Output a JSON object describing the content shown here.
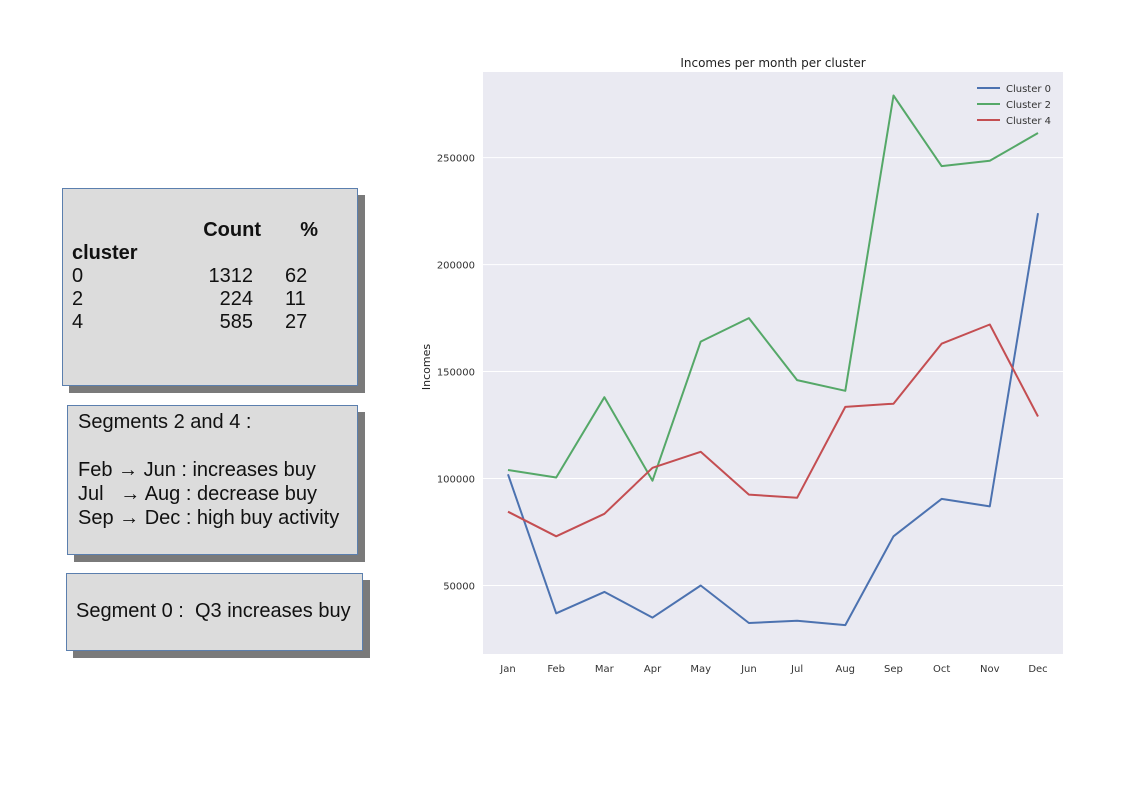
{
  "table": {
    "header_count": "Count",
    "header_pct": "%",
    "index_label": "cluster",
    "rows": [
      {
        "cluster": "0",
        "count": "1312",
        "pct": "62"
      },
      {
        "cluster": "2",
        "count": "224",
        "pct": "11"
      },
      {
        "cluster": "4",
        "count": "585",
        "pct": "27"
      }
    ]
  },
  "notes": {
    "segments_2_4": {
      "title": "Segments 2 and 4 :",
      "lines": [
        "Feb → Jun : increases buy",
        "Jul   → Aug : decrease buy",
        "Sep → Dec : high buy activity"
      ]
    },
    "segment_0": "Segment 0 :  Q3 increases buy"
  },
  "chart_data": {
    "type": "line",
    "title": "Incomes per month per cluster",
    "xlabel": "",
    "ylabel": "Incomes",
    "categories": [
      "Jan",
      "Feb",
      "Mar",
      "Apr",
      "May",
      "Jun",
      "Jul",
      "Aug",
      "Sep",
      "Oct",
      "Nov",
      "Dec"
    ],
    "ylim": [
      18000,
      290000
    ],
    "yticks": [
      50000,
      100000,
      150000,
      200000,
      250000
    ],
    "grid": true,
    "legend": "top-right",
    "series": [
      {
        "name": "Cluster 0",
        "color": "#4c72b0",
        "values": [
          102000,
          37000,
          47000,
          35000,
          50000,
          32500,
          33500,
          31500,
          73000,
          90500,
          87000,
          224000
        ]
      },
      {
        "name": "Cluster 2",
        "color": "#55a868",
        "values": [
          104000,
          100500,
          138000,
          99000,
          164000,
          175000,
          146000,
          141000,
          279000,
          246000,
          248500,
          261500
        ]
      },
      {
        "name": "Cluster 4",
        "color": "#c44e52",
        "values": [
          84500,
          73000,
          83500,
          105000,
          112500,
          92500,
          91000,
          133500,
          135000,
          163000,
          172000,
          129000
        ]
      }
    ]
  }
}
